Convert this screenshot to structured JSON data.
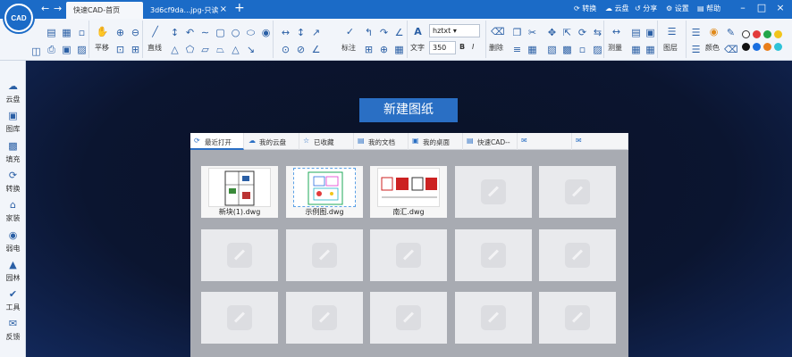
{
  "app": {
    "logo_text": "CAD",
    "tabs": [
      {
        "label": "快速CAD-首页"
      },
      {
        "label": "3d6cf9da...jpg-只读"
      }
    ],
    "title_actions": [
      "转换",
      "云盘",
      "分享",
      "设置",
      "帮助"
    ]
  },
  "toolbar": {
    "labels": {
      "pan": "平移",
      "line": "直线",
      "annotate": "标注",
      "text": "文字",
      "delete": "删除",
      "measure": "测量",
      "layer": "图层",
      "color": "颜色"
    },
    "font_value": "hztxt",
    "size_value": "350",
    "bold": "B",
    "italic": "I",
    "swatch_colors": [
      "#ffffff",
      "#e23b3b",
      "#22a64a",
      "#f2c51b",
      "#111111",
      "#1a6fe0",
      "#e97f1c",
      "#2fc3d8"
    ]
  },
  "sidebar": {
    "items": [
      {
        "label": "云盘"
      },
      {
        "label": "图库"
      },
      {
        "label": "填充"
      },
      {
        "label": "转换"
      },
      {
        "label": "家装"
      },
      {
        "label": "弱电"
      },
      {
        "label": "园林"
      },
      {
        "label": "工具"
      },
      {
        "label": "反馈"
      }
    ]
  },
  "main": {
    "new_drawing_label": "新建图纸",
    "panel_tabs": [
      {
        "label": "最近打开"
      },
      {
        "label": "我的云盘"
      },
      {
        "label": "已收藏"
      },
      {
        "label": "我的文档"
      },
      {
        "label": "我的桌面"
      },
      {
        "label": "快速CAD--"
      },
      {
        "label": ""
      },
      {
        "label": ""
      }
    ],
    "files": [
      {
        "name": "新块(1).dwg"
      },
      {
        "name": "示例图.dwg"
      },
      {
        "name": "南汇.dwg"
      }
    ]
  }
}
